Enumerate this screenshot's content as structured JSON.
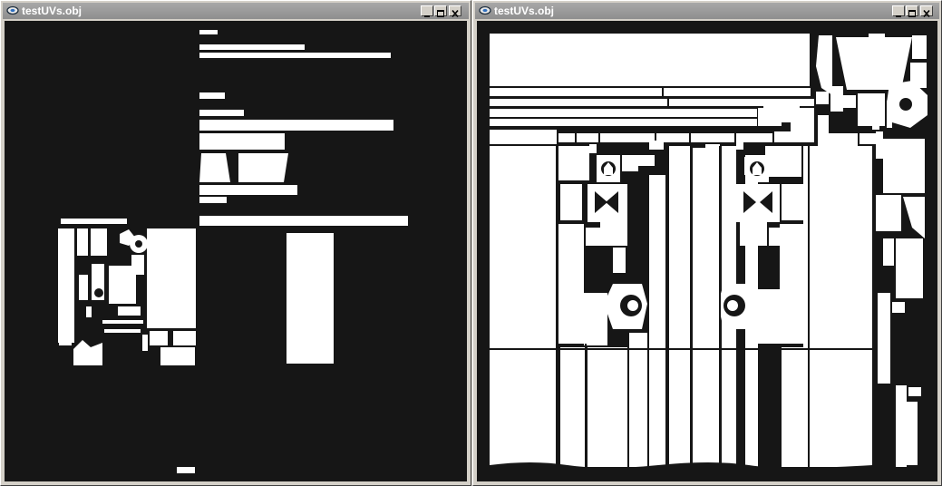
{
  "windows": [
    {
      "id": "left",
      "title": "testUVs.obj",
      "canvas_bg": "#161616",
      "fill": "#ffffff"
    },
    {
      "id": "right",
      "title": "testUVs.obj",
      "canvas_bg": "#161616",
      "fill": "#ffffff"
    }
  ],
  "window_controls": [
    {
      "name": "minimize-button",
      "icon": "minimize-icon"
    },
    {
      "name": "maximize-button",
      "icon": "maximize-icon"
    },
    {
      "name": "close-button",
      "icon": "close-icon"
    }
  ],
  "colors": {
    "titlebar": "#9c9c9c",
    "frame": "#d4d0c8",
    "uv_islands": "#ffffff",
    "canvas": "#161616"
  }
}
